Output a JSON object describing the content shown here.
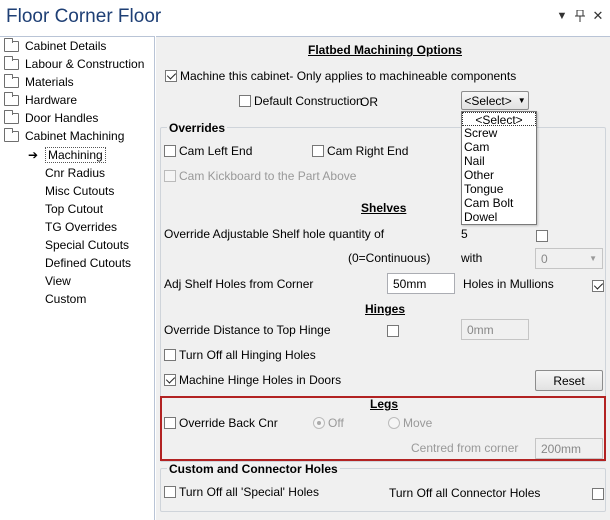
{
  "window": {
    "title": "Floor Corner Floor"
  },
  "tree": {
    "items": [
      {
        "label": "Cabinet Details"
      },
      {
        "label": "Labour & Construction"
      },
      {
        "label": "Materials"
      },
      {
        "label": "Hardware"
      },
      {
        "label": "Door Handles"
      },
      {
        "label": "Cabinet Machining"
      }
    ],
    "children": [
      {
        "label": "Machining"
      },
      {
        "label": "Cnr Radius"
      },
      {
        "label": "Misc Cutouts"
      },
      {
        "label": "Top Cutout"
      },
      {
        "label": "TG Overrides"
      },
      {
        "label": "Special Cutouts"
      },
      {
        "label": "Defined Cutouts"
      },
      {
        "label": "View"
      },
      {
        "label": "Custom"
      }
    ]
  },
  "main": {
    "heading": "Flatbed Machining Options",
    "machine_cabinet": "Machine this cabinet- Only applies to machineable components",
    "default_construction": "Default Construction",
    "or_label": "OR",
    "select_value": "<Select>",
    "dropdown_options": [
      "<Select>",
      "Screw",
      "Cam",
      "Nail",
      "Other",
      "Tongue",
      "Cam Bolt",
      "Dowel"
    ],
    "overrides": {
      "title": "Overrides",
      "cam_left": "Cam Left End",
      "cam_right": "Cam Right End",
      "cam_kickboard": "Cam Kickboard to the Part Above",
      "shelves_heading": "Shelves",
      "shelf_qty_label": "Override Adjustable Shelf hole quantity of",
      "shelf_qty_value": "5",
      "continuous_label": "(0=Continuous)",
      "with_label": "with",
      "with_value": "0",
      "adj_shelf_label": "Adj Shelf Holes from Corner",
      "adj_shelf_value": "50mm",
      "holes_mullions": "Holes in Mullions",
      "hinges_heading": "Hinges",
      "hinge_distance_label": "Override Distance to Top Hinge",
      "hinge_distance_value": "0mm",
      "turn_off_hinging": "Turn Off all Hinging Holes",
      "machine_hinge": "Machine Hinge Holes in Doors",
      "reset_label": "Reset",
      "legs_heading": "Legs",
      "override_back": "Override Back Cnr",
      "off_label": "Off",
      "move_label": "Move",
      "centred_label": "Centred from corner",
      "centred_value": "200mm"
    },
    "custom": {
      "title": "Custom and Connector Holes",
      "special_holes": "Turn Off all 'Special' Holes",
      "connector_holes": "Turn Off all Connector Holes"
    }
  },
  "colors": {
    "title": "#1e3f75",
    "highlight_border": "#b22222",
    "panel_bg": "#f0f0f0"
  }
}
